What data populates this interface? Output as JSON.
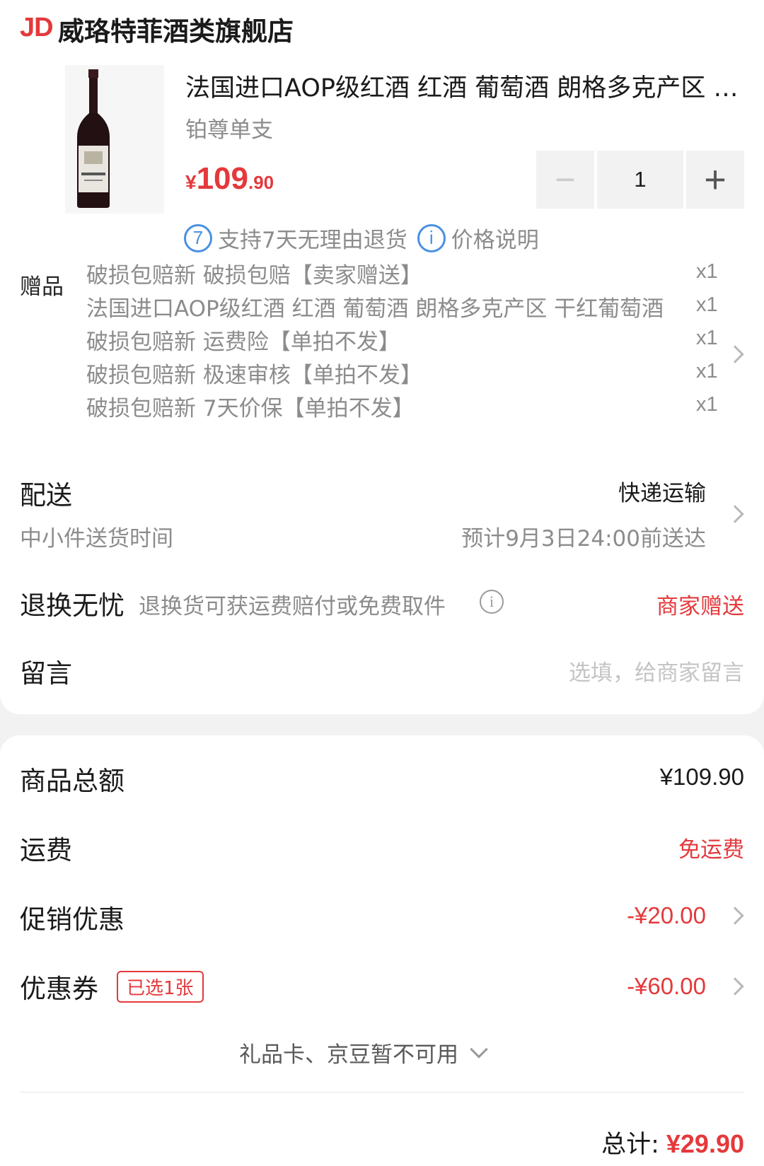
{
  "shop": {
    "logo": "JD",
    "name": "威珞特菲酒类旗舰店"
  },
  "product": {
    "image": "wine-bottle",
    "title": "法国进口AOP级红酒 红酒 葡萄酒 朗格多克产区 干红葡萄酒 铂尊单支",
    "spec": "铂尊单支",
    "price_symbol": "¥",
    "price_int": "109",
    "price_dec": ".90",
    "quantity": "1",
    "minus_label": "−",
    "plus_label": "+",
    "services": [
      {
        "icon": "seven-day-return-icon",
        "badge": "7",
        "label": "支持7天无理由退货"
      },
      {
        "icon": "info-icon",
        "badge": "i",
        "label": "价格说明"
      }
    ]
  },
  "gifts": {
    "label": "赠品",
    "items": [
      {
        "name": "破损包赔新 破损包赔【卖家赠送】",
        "qty": "x1"
      },
      {
        "name": "法国进口AOP级红酒 红酒 葡萄酒 朗格多克产区 干红葡萄酒",
        "qty": "x1"
      },
      {
        "name": "破损包赔新 运费险【单拍不发】",
        "qty": "x1"
      },
      {
        "name": "破损包赔新 极速审核【单拍不发】",
        "qty": "x1"
      },
      {
        "name": "破损包赔新 7天价保【单拍不发】",
        "qty": "x1"
      }
    ]
  },
  "delivery": {
    "title": "配送",
    "method": "快递运输",
    "sub_label": "中小件送货时间",
    "eta": "预计9月3日24:00前送达"
  },
  "returns": {
    "title": "退换无忧",
    "desc": "退换货可获运费赔付或免费取件",
    "info_badge": "i",
    "value": "商家赠送"
  },
  "message": {
    "title": "留言",
    "placeholder": "选填，给商家留言"
  },
  "summary": {
    "goods_total_label": "商品总额",
    "goods_total": "¥109.90",
    "shipping_label": "运费",
    "shipping": "免运费",
    "promo_label": "促销优惠",
    "promo": "-¥20.00",
    "coupon_label": "优惠券",
    "coupon_tag": "已选1张",
    "coupon": "-¥60.00",
    "unavailable": "礼品卡、京豆暂不可用"
  },
  "footer": {
    "total_label": "总计:",
    "total": "¥29.90"
  },
  "colors": {
    "accent": "#e4393c",
    "link": "#4a90e2",
    "muted": "#8c8c8c"
  }
}
